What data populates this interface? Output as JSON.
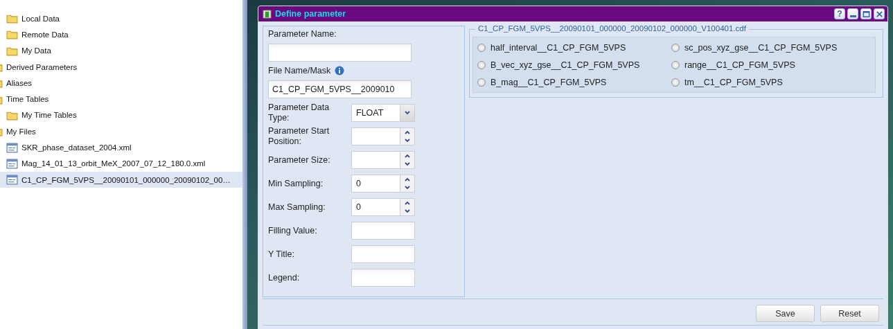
{
  "tree": {
    "continued_items": [
      {
        "label": "Local Data",
        "kind": "folder",
        "selected": false
      },
      {
        "label": "Remote Data",
        "kind": "folder",
        "selected": false
      },
      {
        "label": "My Data",
        "kind": "folder",
        "selected": false
      }
    ],
    "items": [
      {
        "label": "Derived Parameters",
        "kind": "folder",
        "selected": false
      },
      {
        "label": "Aliases",
        "kind": "folder",
        "selected": false
      },
      {
        "label": "Time Tables",
        "kind": "folder",
        "selected": false,
        "children": [
          {
            "label": "My Time Tables",
            "kind": "folder",
            "selected": false
          }
        ]
      },
      {
        "label": "My Files",
        "kind": "folder",
        "selected": false,
        "children": [
          {
            "label": "SKR_phase_dataset_2004.xml",
            "kind": "file",
            "selected": false
          },
          {
            "label": "Mag_14_01_13_orbit_MeX_2007_07_12_180.0.xml",
            "kind": "file",
            "selected": false
          },
          {
            "label": "C1_CP_FGM_5VPS__20090101_000000_20090102_00…",
            "kind": "file",
            "selected": true
          }
        ]
      }
    ]
  },
  "dialog": {
    "title": "Define parameter",
    "help_label": "?",
    "fields": [
      {
        "kind": "stacked",
        "label": "Parameter Name:",
        "info": false
      },
      {
        "kind": "stacked",
        "label": "File Name/Mask",
        "value": "C1_CP_FGM_5VPS__2009010",
        "info": true
      },
      {
        "kind": "select",
        "label": "Parameter Data Type:",
        "value": "FLOAT"
      },
      {
        "kind": "spinner",
        "label": "Parameter Start Position:"
      },
      {
        "kind": "spinner",
        "label": "Parameter Size:"
      },
      {
        "kind": "spinner",
        "label": "Min Sampling:",
        "value": "0"
      },
      {
        "kind": "spinner",
        "label": "Max Sampling:",
        "value": "0"
      },
      {
        "kind": "text",
        "label": "Filling Value:"
      },
      {
        "kind": "text",
        "label": "Y Title:"
      },
      {
        "kind": "text",
        "label": "Legend:"
      }
    ],
    "file_group": {
      "title": "C1_CP_FGM_5VPS__20090101_000000_20090102_000000_V100401.cdf",
      "options": [
        {
          "label": "half_interval__C1_CP_FGM_5VPS",
          "selected": false
        },
        {
          "label": "sc_pos_xyz_gse__C1_CP_FGM_5VPS",
          "selected": false
        },
        {
          "label": "B_vec_xyz_gse__C1_CP_FGM_5VPS",
          "selected": false
        },
        {
          "label": "range__C1_CP_FGM_5VPS",
          "selected": false
        },
        {
          "label": "B_mag__C1_CP_FGM_5VPS",
          "selected": false
        },
        {
          "label": "tm__C1_CP_FGM_5VPS",
          "selected": false
        }
      ]
    },
    "buttons": [
      "Save",
      "Reset"
    ]
  }
}
